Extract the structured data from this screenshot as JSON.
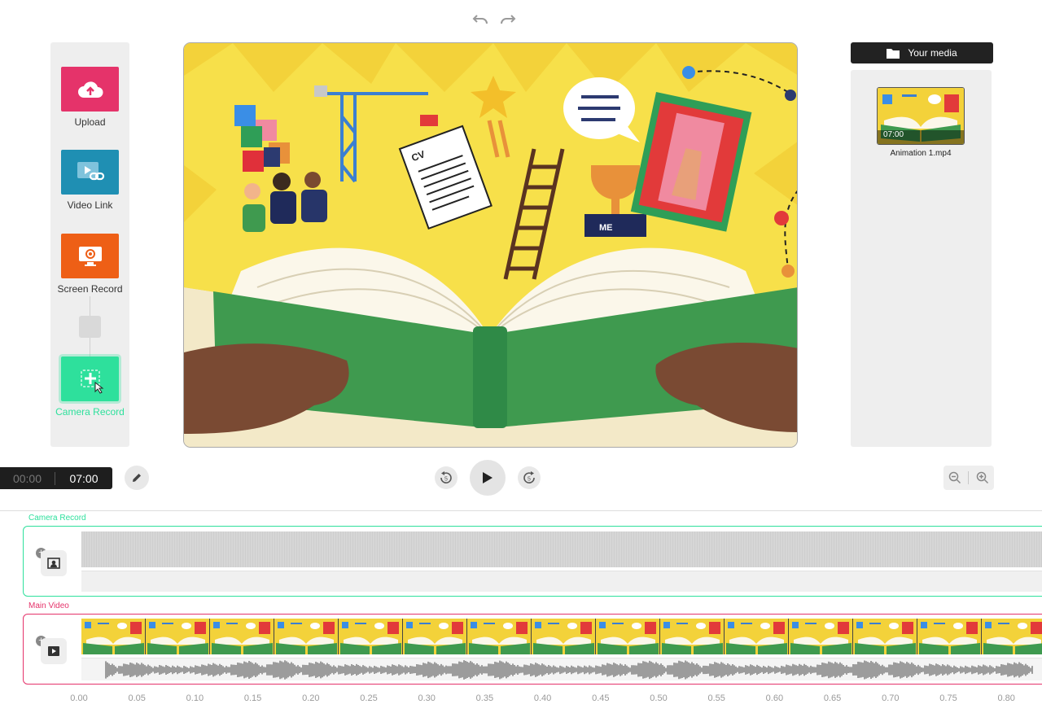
{
  "tools": {
    "upload": {
      "label": "Upload",
      "color": "#e5336a"
    },
    "video_link": {
      "label": "Video Link",
      "color": "#1f8fb3"
    },
    "screen_record": {
      "label": "Screen Record",
      "color": "#ee5f16"
    },
    "camera_record": {
      "label": "Camera Record",
      "color": "#2ee09c"
    }
  },
  "media": {
    "header_label": "Your media",
    "items": [
      {
        "name": "Animation 1.mp4",
        "duration": "07:00"
      }
    ]
  },
  "player": {
    "current_time": "00:00",
    "total_time": "07:00",
    "rewind_seconds": "5",
    "forward_seconds": "5"
  },
  "timeline": {
    "tracks": [
      {
        "label": "Camera Record",
        "color": "#2ee09c"
      },
      {
        "label": "Main Video",
        "color": "#e5336a"
      }
    ],
    "ruler_ticks": [
      "0.00",
      "0.05",
      "0.10",
      "0.15",
      "0.20",
      "0.25",
      "0.30",
      "0.35",
      "0.40",
      "0.45",
      "0.50",
      "0.55",
      "0.60",
      "0.65",
      "0.70",
      "0.75",
      "0.80"
    ]
  },
  "icons": {
    "undo": "undo-icon",
    "redo": "redo-icon",
    "folder": "folder-icon",
    "edit": "pencil-icon",
    "play": "play-icon",
    "zoom_out": "zoom-out-icon",
    "zoom_in": "zoom-in-icon"
  }
}
